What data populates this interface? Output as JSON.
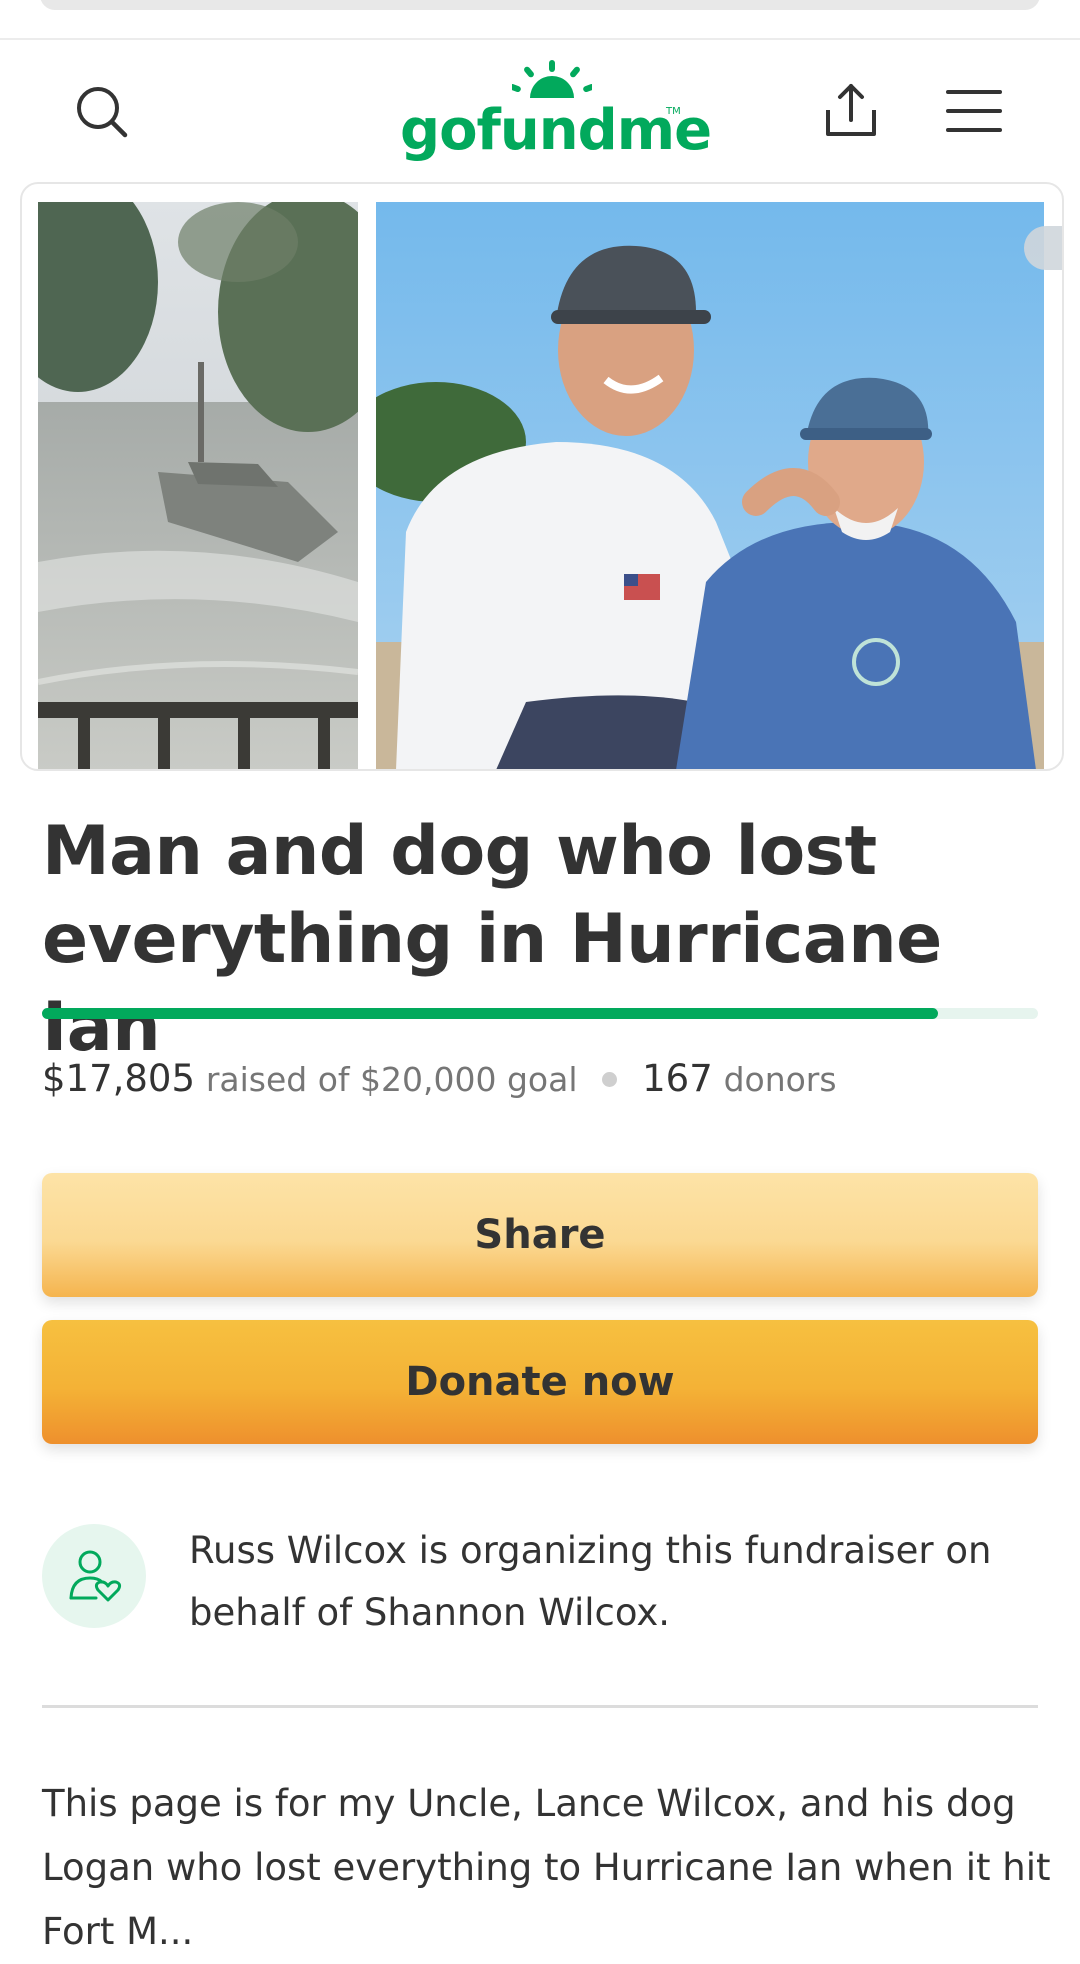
{
  "app": {
    "brand": "gofundme",
    "tm": "TM"
  },
  "colors": {
    "brand_green": "#02a95c",
    "share_button": "#fbd993",
    "donate_button": "#f4b236"
  },
  "header": {
    "icons": [
      "search-icon",
      "share-icon",
      "menu-icon"
    ]
  },
  "gallery": {
    "photos": [
      "flooded-street-photo",
      "two-men-photo"
    ]
  },
  "campaign": {
    "title": "Man and dog who lost everything in Hurricane Ian",
    "progress_fraction": 0.9,
    "raised": "$17,805",
    "raised_of_goal": "raised of $20,000 goal",
    "donor_count": "167",
    "donors_label": "donors"
  },
  "buttons": {
    "share_label": "Share",
    "donate_label": "Donate now"
  },
  "organizer": {
    "icon": "person-heart-icon",
    "text": "Russ Wilcox is organizing this fundraiser on behalf of Shannon Wilcox."
  },
  "story": {
    "text": "This page is for my Uncle, Lance Wilcox, and his dog Logan who lost everything to Hurricane Ian when it hit Fort M..."
  }
}
